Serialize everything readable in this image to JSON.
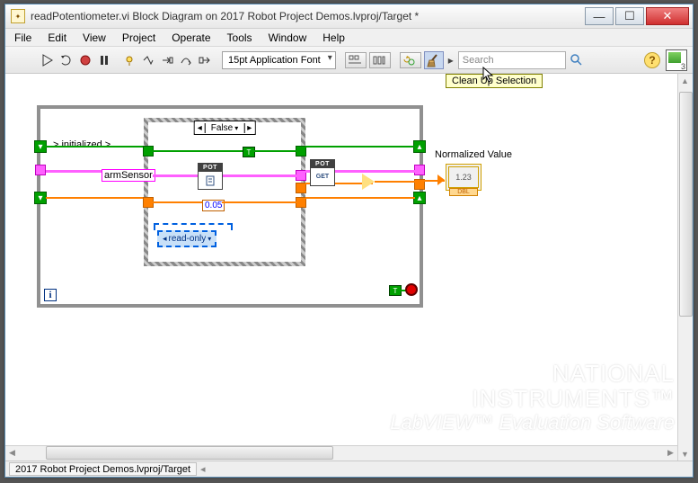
{
  "window": {
    "title": "readPotentiometer.vi Block Diagram on 2017 Robot Project Demos.lvproj/Target *"
  },
  "menu": {
    "items": [
      "File",
      "Edit",
      "View",
      "Project",
      "Operate",
      "Tools",
      "Window",
      "Help"
    ]
  },
  "toolbar": {
    "font": "15pt Application Font",
    "search_placeholder": "Search",
    "tooltip": "Clean Up Selection"
  },
  "diagram": {
    "init_label": "> initialized >",
    "case_value": "False",
    "arm_sensor": "armSensor",
    "const_value": "0.05",
    "readonly_label": "read-only",
    "normalized_label": "Normalized Value",
    "indicator_value": "1.23",
    "indicator_type": "DBL",
    "pot_label": "POT",
    "pot_get": "GET",
    "i_term": "i",
    "bool_true": "T"
  },
  "status": {
    "path": "2017 Robot Project Demos.lvproj/Target"
  },
  "watermark": {
    "l1": "NATIONAL",
    "l2": "INSTRUMENTS",
    "l3": "LabVIEW™ Evaluation Software"
  }
}
